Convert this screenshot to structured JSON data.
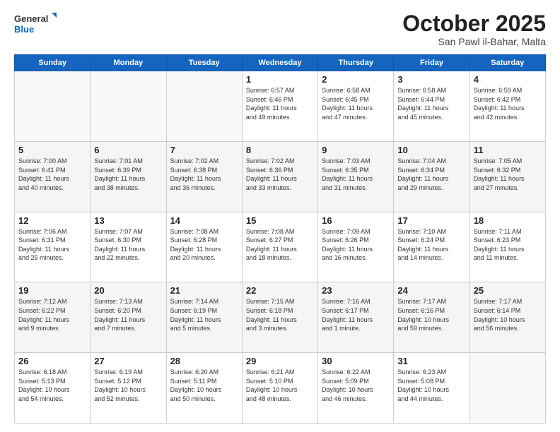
{
  "logo": {
    "general": "General",
    "blue": "Blue"
  },
  "title": {
    "month": "October 2025",
    "location": "San Pawl il-Bahar, Malta"
  },
  "headers": [
    "Sunday",
    "Monday",
    "Tuesday",
    "Wednesday",
    "Thursday",
    "Friday",
    "Saturday"
  ],
  "weeks": [
    [
      {
        "day": "",
        "info": ""
      },
      {
        "day": "",
        "info": ""
      },
      {
        "day": "",
        "info": ""
      },
      {
        "day": "1",
        "info": "Sunrise: 6:57 AM\nSunset: 6:46 PM\nDaylight: 11 hours\nand 49 minutes."
      },
      {
        "day": "2",
        "info": "Sunrise: 6:58 AM\nSunset: 6:45 PM\nDaylight: 11 hours\nand 47 minutes."
      },
      {
        "day": "3",
        "info": "Sunrise: 6:58 AM\nSunset: 6:44 PM\nDaylight: 11 hours\nand 45 minutes."
      },
      {
        "day": "4",
        "info": "Sunrise: 6:59 AM\nSunset: 6:42 PM\nDaylight: 11 hours\nand 42 minutes."
      }
    ],
    [
      {
        "day": "5",
        "info": "Sunrise: 7:00 AM\nSunset: 6:41 PM\nDaylight: 11 hours\nand 40 minutes."
      },
      {
        "day": "6",
        "info": "Sunrise: 7:01 AM\nSunset: 6:39 PM\nDaylight: 11 hours\nand 38 minutes."
      },
      {
        "day": "7",
        "info": "Sunrise: 7:02 AM\nSunset: 6:38 PM\nDaylight: 11 hours\nand 36 minutes."
      },
      {
        "day": "8",
        "info": "Sunrise: 7:02 AM\nSunset: 6:36 PM\nDaylight: 11 hours\nand 33 minutes."
      },
      {
        "day": "9",
        "info": "Sunrise: 7:03 AM\nSunset: 6:35 PM\nDaylight: 11 hours\nand 31 minutes."
      },
      {
        "day": "10",
        "info": "Sunrise: 7:04 AM\nSunset: 6:34 PM\nDaylight: 11 hours\nand 29 minutes."
      },
      {
        "day": "11",
        "info": "Sunrise: 7:05 AM\nSunset: 6:32 PM\nDaylight: 11 hours\nand 27 minutes."
      }
    ],
    [
      {
        "day": "12",
        "info": "Sunrise: 7:06 AM\nSunset: 6:31 PM\nDaylight: 11 hours\nand 25 minutes."
      },
      {
        "day": "13",
        "info": "Sunrise: 7:07 AM\nSunset: 6:30 PM\nDaylight: 11 hours\nand 22 minutes."
      },
      {
        "day": "14",
        "info": "Sunrise: 7:08 AM\nSunset: 6:28 PM\nDaylight: 11 hours\nand 20 minutes."
      },
      {
        "day": "15",
        "info": "Sunrise: 7:08 AM\nSunset: 6:27 PM\nDaylight: 11 hours\nand 18 minutes."
      },
      {
        "day": "16",
        "info": "Sunrise: 7:09 AM\nSunset: 6:26 PM\nDaylight: 11 hours\nand 16 minutes."
      },
      {
        "day": "17",
        "info": "Sunrise: 7:10 AM\nSunset: 6:24 PM\nDaylight: 11 hours\nand 14 minutes."
      },
      {
        "day": "18",
        "info": "Sunrise: 7:11 AM\nSunset: 6:23 PM\nDaylight: 11 hours\nand 11 minutes."
      }
    ],
    [
      {
        "day": "19",
        "info": "Sunrise: 7:12 AM\nSunset: 6:22 PM\nDaylight: 11 hours\nand 9 minutes."
      },
      {
        "day": "20",
        "info": "Sunrise: 7:13 AM\nSunset: 6:20 PM\nDaylight: 11 hours\nand 7 minutes."
      },
      {
        "day": "21",
        "info": "Sunrise: 7:14 AM\nSunset: 6:19 PM\nDaylight: 11 hours\nand 5 minutes."
      },
      {
        "day": "22",
        "info": "Sunrise: 7:15 AM\nSunset: 6:18 PM\nDaylight: 11 hours\nand 3 minutes."
      },
      {
        "day": "23",
        "info": "Sunrise: 7:16 AM\nSunset: 6:17 PM\nDaylight: 11 hours\nand 1 minute."
      },
      {
        "day": "24",
        "info": "Sunrise: 7:17 AM\nSunset: 6:16 PM\nDaylight: 10 hours\nand 59 minutes."
      },
      {
        "day": "25",
        "info": "Sunrise: 7:17 AM\nSunset: 6:14 PM\nDaylight: 10 hours\nand 56 minutes."
      }
    ],
    [
      {
        "day": "26",
        "info": "Sunrise: 6:18 AM\nSunset: 5:13 PM\nDaylight: 10 hours\nand 54 minutes."
      },
      {
        "day": "27",
        "info": "Sunrise: 6:19 AM\nSunset: 5:12 PM\nDaylight: 10 hours\nand 52 minutes."
      },
      {
        "day": "28",
        "info": "Sunrise: 6:20 AM\nSunset: 5:11 PM\nDaylight: 10 hours\nand 50 minutes."
      },
      {
        "day": "29",
        "info": "Sunrise: 6:21 AM\nSunset: 5:10 PM\nDaylight: 10 hours\nand 48 minutes."
      },
      {
        "day": "30",
        "info": "Sunrise: 6:22 AM\nSunset: 5:09 PM\nDaylight: 10 hours\nand 46 minutes."
      },
      {
        "day": "31",
        "info": "Sunrise: 6:23 AM\nSunset: 5:08 PM\nDaylight: 10 hours\nand 44 minutes."
      },
      {
        "day": "",
        "info": ""
      }
    ]
  ]
}
